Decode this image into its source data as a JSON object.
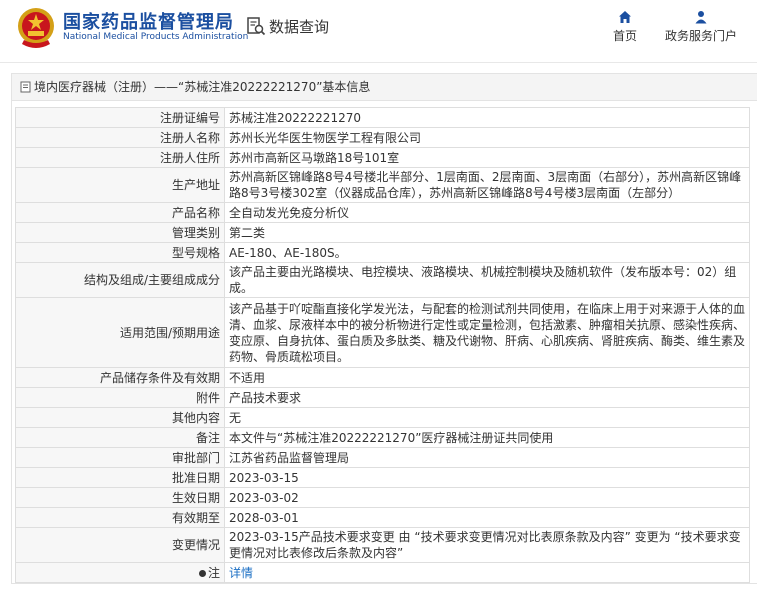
{
  "header": {
    "brand_cn": "国家药品监督管理局",
    "brand_en": "National Medical Products Administration",
    "query_label": "数据查询",
    "nav_home": "首页",
    "nav_portal": "政务服务门户"
  },
  "section_title": "境内医疗器械（注册）——“苏械注准20222221270”基本信息",
  "rows": [
    {
      "label": "注册证编号",
      "value": "苏械注准20222221270"
    },
    {
      "label": "注册人名称",
      "value": "苏州长光华医生物医学工程有限公司"
    },
    {
      "label": "注册人住所",
      "value": "苏州市高新区马墩路18号101室"
    },
    {
      "label": "生产地址",
      "value": "苏州高新区锦峰路8号4号楼北半部分、1层南面、2层南面、3层南面（右部分），苏州高新区锦峰路8号3号楼302室（仪器成品仓库），苏州高新区锦峰路8号4号楼3层南面（左部分）"
    },
    {
      "label": "产品名称",
      "value": "全自动发光免疫分析仪"
    },
    {
      "label": "管理类别",
      "value": "第二类"
    },
    {
      "label": "型号规格",
      "value": "AE-180、AE-180S。"
    },
    {
      "label": "结构及组成/主要组成成分",
      "value": "该产品主要由光路模块、电控模块、液路模块、机械控制模块及随机软件（发布版本号：02）组成。"
    },
    {
      "label": "适用范围/预期用途",
      "value": "该产品基于吖啶酯直接化学发光法，与配套的检测试剂共同使用，在临床上用于对来源于人体的血清、血浆、尿液样本中的被分析物进行定性或定量检测，包括激素、肿瘤相关抗原、感染性疾病、变应原、自身抗体、蛋白质及多肽类、糖及代谢物、肝病、心肌疾病、肾脏疾病、酶类、维生素及药物、骨质疏松项目。"
    },
    {
      "label": "产品储存条件及有效期",
      "value": "不适用"
    },
    {
      "label": "附件",
      "value": "产品技术要求"
    },
    {
      "label": "其他内容",
      "value": "无"
    },
    {
      "label": "备注",
      "value": "本文件与“苏械注准20222221270”医疗器械注册证共同使用"
    },
    {
      "label": "审批部门",
      "value": "江苏省药品监督管理局"
    },
    {
      "label": "批准日期",
      "value": "2023-03-15"
    },
    {
      "label": "生效日期",
      "value": "2023-03-02"
    },
    {
      "label": "有效期至",
      "value": "2028-03-01"
    },
    {
      "label": "变更情况",
      "value": "2023-03-15产品技术要求变更 由 “技术要求变更情况对比表原条款及内容” 变更为 “技术要求变更情况对比表修改后条款及内容”"
    }
  ],
  "note": {
    "label": "注",
    "value": "详情"
  }
}
